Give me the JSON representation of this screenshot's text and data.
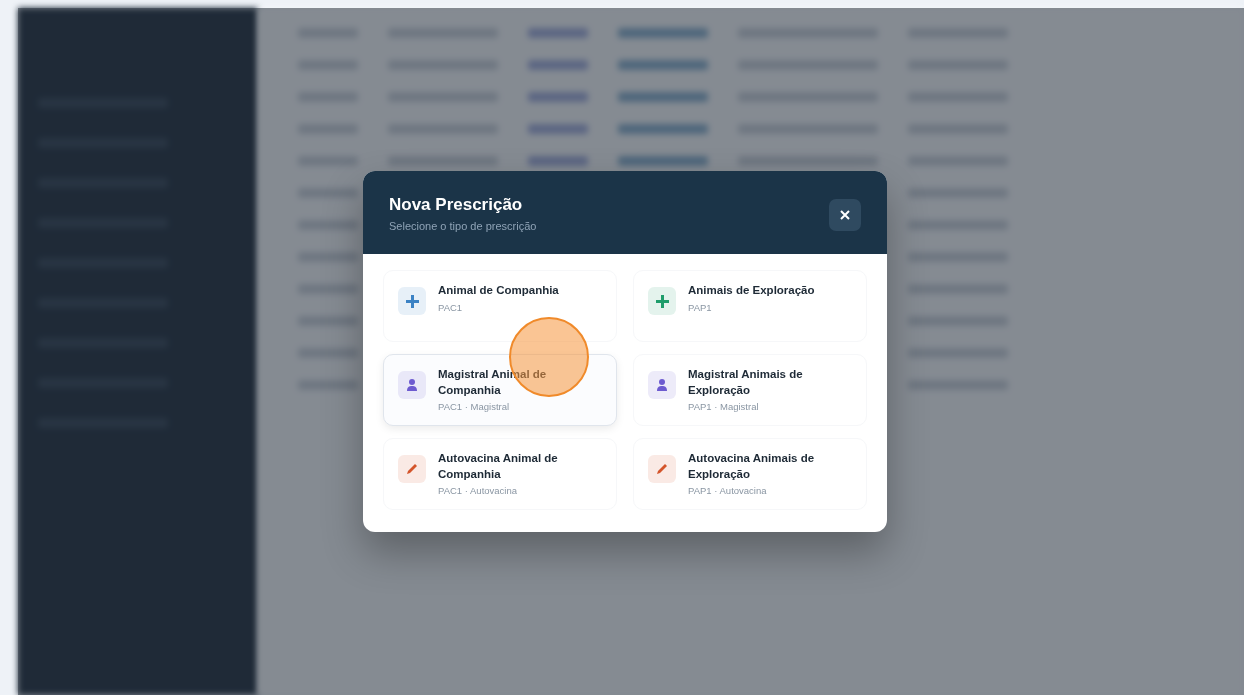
{
  "dialog": {
    "title": "Nova Prescrição",
    "subtitle": "Selecione o tipo de prescrição",
    "options": [
      {
        "kind": "plus",
        "color": "#3b82c4",
        "title": "Animal de Companhia",
        "code": "PAC1",
        "hovered": false
      },
      {
        "kind": "plus",
        "color": "#1f9d6b",
        "title": "Animais de Exploração",
        "code": "PAP1",
        "hovered": false
      },
      {
        "kind": "magistral",
        "color": "#6d5bd0",
        "title": "Magistral Animal de Companhia",
        "code": "PAC1 · Magistral",
        "hovered": true
      },
      {
        "kind": "magistral",
        "color": "#6d5bd0",
        "title": "Magistral Animais de Exploração",
        "code": "PAP1 · Magistral",
        "hovered": false
      },
      {
        "kind": "autovacina",
        "color": "#d4552b",
        "title": "Autovacina Animal de Companhia",
        "code": "PAC1 · Autovacina",
        "hovered": false
      },
      {
        "kind": "autovacina",
        "color": "#d4552b",
        "title": "Autovacina Animais de Exploração",
        "code": "PAP1 · Autovacina",
        "hovered": false
      }
    ]
  }
}
